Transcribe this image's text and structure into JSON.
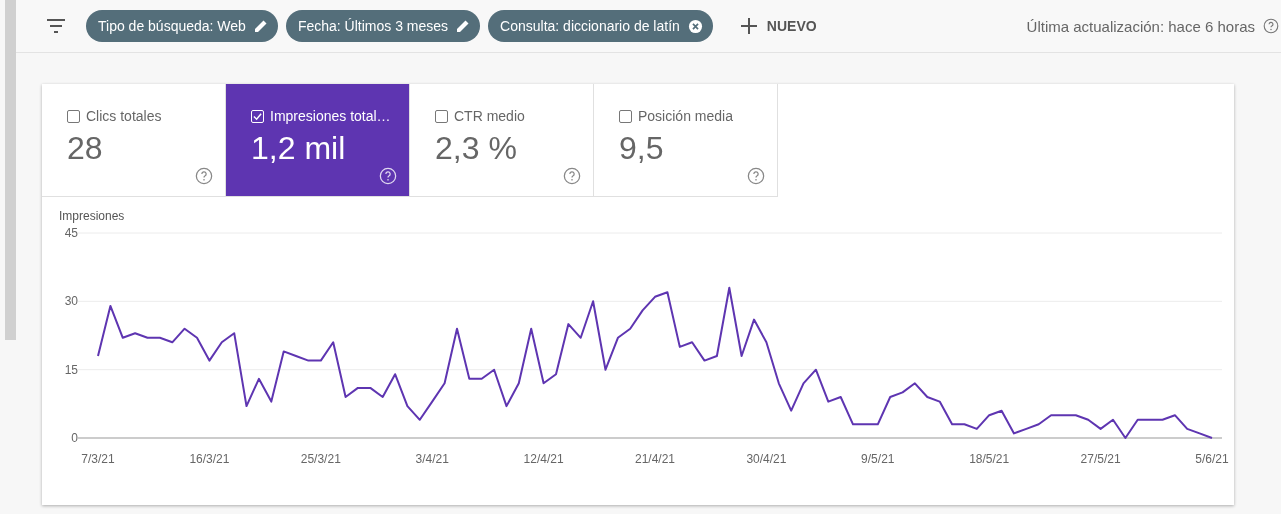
{
  "toolbar": {
    "filters": [
      {
        "label": "Tipo de búsqueda: Web",
        "kind": "edit"
      },
      {
        "label": "Fecha: Últimos 3 meses",
        "kind": "edit"
      },
      {
        "label": "Consulta: diccionario de latín",
        "kind": "remove"
      }
    ],
    "new_button": "NUEVO",
    "last_update": "Última actualización: hace 6 horas"
  },
  "metrics": [
    {
      "label": "Clics totales",
      "value": "28",
      "selected": false
    },
    {
      "label": "Impresiones total…",
      "value": "1,2 mil",
      "selected": true
    },
    {
      "label": "CTR medio",
      "value": "2,3 %",
      "selected": false
    },
    {
      "label": "Posición media",
      "value": "9,5",
      "selected": false
    }
  ],
  "chart": {
    "chart_data": {
      "type": "line",
      "ylabel": "Impresiones",
      "ylim": [
        0,
        45
      ],
      "yticks": [
        0,
        15,
        30,
        45
      ],
      "categories": [
        "7/3/21",
        null,
        null,
        null,
        null,
        null,
        null,
        null,
        null,
        "16/3/21",
        null,
        null,
        null,
        null,
        null,
        null,
        null,
        null,
        "25/3/21",
        null,
        null,
        null,
        null,
        null,
        null,
        null,
        null,
        "3/4/21",
        null,
        null,
        null,
        null,
        null,
        null,
        null,
        null,
        "12/4/21",
        null,
        null,
        null,
        null,
        null,
        null,
        null,
        null,
        "21/4/21",
        null,
        null,
        null,
        null,
        null,
        null,
        null,
        null,
        "30/4/21",
        null,
        null,
        null,
        null,
        null,
        null,
        null,
        null,
        "9/5/21",
        null,
        null,
        null,
        null,
        null,
        null,
        null,
        null,
        "18/5/21",
        null,
        null,
        null,
        null,
        null,
        null,
        null,
        null,
        "27/5/21",
        null,
        null,
        null,
        null,
        null,
        null,
        null,
        null,
        "5/6/21"
      ],
      "series": [
        {
          "color": "#5e35b1",
          "values": [
            18,
            29,
            22,
            23,
            22,
            22,
            21,
            24,
            22,
            17,
            21,
            23,
            7,
            13,
            8,
            19,
            18,
            17,
            17,
            21,
            9,
            11,
            11,
            9,
            14,
            7,
            4,
            8,
            12,
            24,
            13,
            13,
            15,
            7,
            12,
            24,
            12,
            14,
            25,
            22,
            30,
            15,
            22,
            24,
            28,
            31,
            32,
            20,
            21,
            17,
            18,
            33,
            18,
            26,
            21,
            12,
            6,
            12,
            15,
            8,
            9,
            3,
            3,
            3,
            9,
            10,
            12,
            9,
            8,
            3,
            3,
            2,
            5,
            6,
            1,
            2,
            3,
            5,
            5,
            5,
            4,
            2,
            4,
            0,
            4,
            4,
            4,
            5,
            2,
            1,
            0
          ]
        }
      ]
    }
  }
}
